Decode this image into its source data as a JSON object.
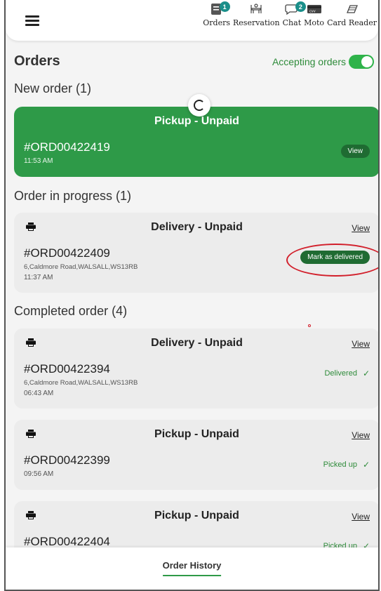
{
  "nav": {
    "items": [
      {
        "label": "Orders",
        "icon": "orders-icon",
        "badge": "1"
      },
      {
        "label": "Reservation",
        "icon": "reservation-icon"
      },
      {
        "label": "Chat",
        "icon": "chat-icon",
        "badge": "2"
      },
      {
        "label": "Moto",
        "icon": "cvv-card-icon"
      },
      {
        "label": "Card Reader",
        "icon": "card-reader-icon"
      }
    ]
  },
  "page": {
    "title": "Orders",
    "accepting_label": "Accepting orders",
    "accepting_on": true
  },
  "sections": {
    "new": "New order (1)",
    "progress": "Order in progress (1)",
    "completed": "Completed order (4)"
  },
  "new_order": {
    "title": "Pickup - Unpaid",
    "order_no": "#ORD00422419",
    "time": "11:53 AM",
    "button": "View"
  },
  "in_progress": {
    "title": "Delivery - Unpaid",
    "order_no": "#ORD00422409",
    "address": "6,Caldmore Road,WALSALL,WS13RB",
    "time": "11:37 AM",
    "view": "View",
    "action": "Mark as delivered"
  },
  "completed": [
    {
      "title": "Delivery - Unpaid",
      "order_no": "#ORD00422394",
      "address": "6,Caldmore Road,WALSALL,WS13RB",
      "time": "06:43 AM",
      "view": "View",
      "status": "Delivered"
    },
    {
      "title": "Pickup - Unpaid",
      "order_no": "#ORD00422399",
      "time": "09:56 AM",
      "view": "View",
      "status": "Picked up"
    },
    {
      "title": "Pickup - Unpaid",
      "order_no": "#ORD00422404",
      "view": "View",
      "status": "Picked up"
    }
  ],
  "footer": {
    "history": "Order History"
  },
  "colors": {
    "green": "#2e9a48",
    "dark_green": "#1f6b32",
    "badge": "#1a8f8a",
    "annotation": "#d21f2b"
  }
}
